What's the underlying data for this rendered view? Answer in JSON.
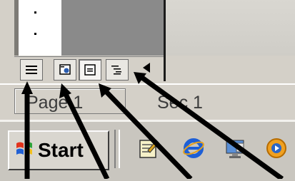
{
  "view_buttons": [
    {
      "name": "normal-view-button",
      "icon": "normal-view-icon"
    },
    {
      "name": "web-layout-view-button",
      "icon": "web-layout-icon"
    },
    {
      "name": "print-layout-view-button",
      "icon": "print-layout-icon",
      "pressed": true
    },
    {
      "name": "outline-view-button",
      "icon": "outline-view-icon"
    }
  ],
  "status": {
    "page_text": "Page 1",
    "section_text": "Sec 1"
  },
  "taskbar": {
    "start_label": "Start",
    "quick_launch": [
      {
        "name": "quick-launch-notepad",
        "icon": "notepad-icon"
      },
      {
        "name": "quick-launch-internet-explorer",
        "icon": "internet-explorer-icon"
      },
      {
        "name": "quick-launch-desktop",
        "icon": "desktop-icon"
      },
      {
        "name": "quick-launch-media-player",
        "icon": "media-player-icon"
      }
    ]
  },
  "colors": {
    "face": "#d4d0c8",
    "arrow": "#000000"
  }
}
